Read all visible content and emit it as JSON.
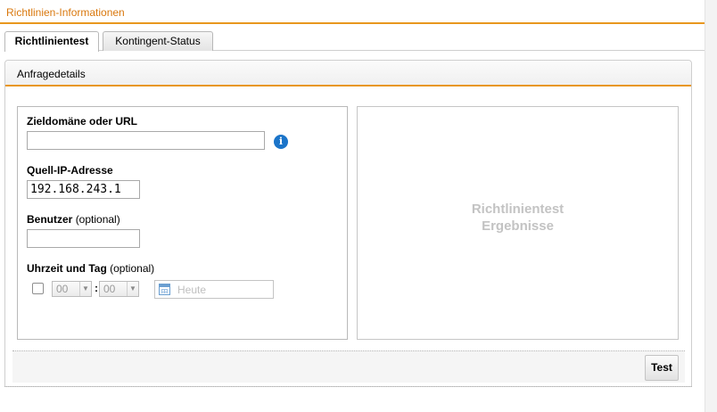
{
  "header": {
    "title": "Richtlinien-Informationen"
  },
  "tabs": [
    {
      "label": "Richtlinientest",
      "active": true
    },
    {
      "label": "Kontingent-Status",
      "active": false
    }
  ],
  "panel": {
    "title": "Anfragedetails"
  },
  "form": {
    "target_label": "Zieldomäne oder URL",
    "target_value": "",
    "source_ip_label": "Quell-IP-Adresse",
    "source_ip_value": "192.168.243.1",
    "user_label": "Benutzer",
    "user_optional": "(optional)",
    "user_value": "",
    "time_label": "Uhrzeit und Tag",
    "time_optional": "(optional)",
    "hour_value": "00",
    "minute_value": "00",
    "time_separator": ":",
    "date_placeholder": "Heute",
    "time_enabled": false
  },
  "results": {
    "line1": "Richtlinientest",
    "line2": "Ergebnisse"
  },
  "footer": {
    "test_label": "Test"
  },
  "colors": {
    "accent": "#e8971e",
    "title_text": "#d9780e",
    "info_icon": "#1b74c9"
  },
  "icons": {
    "info": "info-icon",
    "calendar": "calendar-icon",
    "dropdown": "chevron-down-icon"
  }
}
